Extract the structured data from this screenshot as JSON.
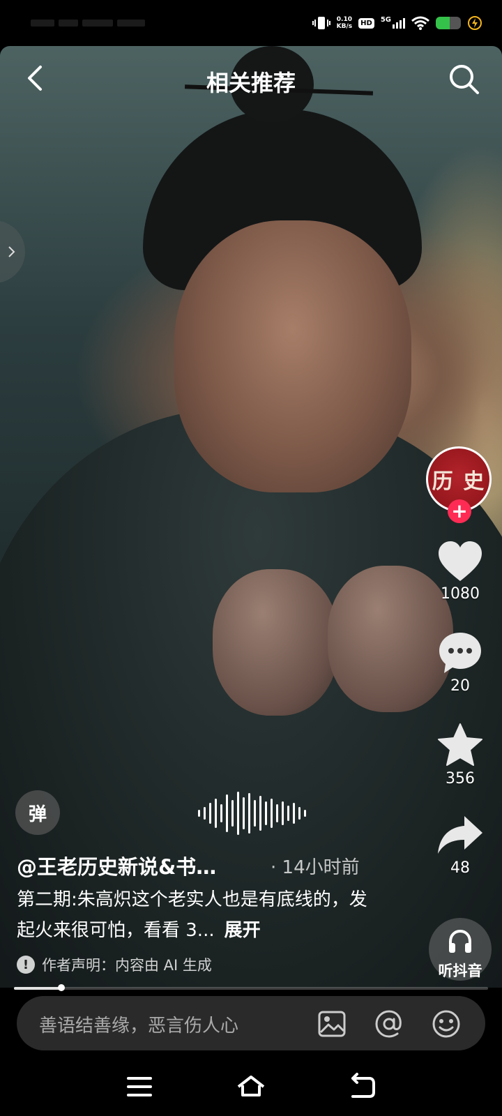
{
  "status_bar": {
    "net_speed_value": "0.10",
    "net_speed_unit": "KB/s",
    "hd_badge": "HD",
    "network": "5G",
    "battery_level": 0.55,
    "battery_color": "#35c24a"
  },
  "header": {
    "title": "相关推荐"
  },
  "rail": {
    "avatar_text": "历 史",
    "follow_symbol": "+",
    "likes": "1080",
    "comments": "20",
    "favorites": "356",
    "shares": "48",
    "listen_label": "听抖音"
  },
  "video": {
    "danmu_label": "弹",
    "author": "@王老历史新说&书…",
    "time": "· 14小时前",
    "description": "第二期:朱高炽这个老实人也是有底线的，发起火来很可怕，看看 3...",
    "expand_label": "展开",
    "notice_icon": "!",
    "notice": "作者声明：内容由 AI 生成",
    "progress": 0.1
  },
  "comment_bar": {
    "placeholder": "善语结善缘，恶言伤人心"
  },
  "colors": {
    "accent": "#fe2c55",
    "avatar_bg": "#9b1b21"
  }
}
